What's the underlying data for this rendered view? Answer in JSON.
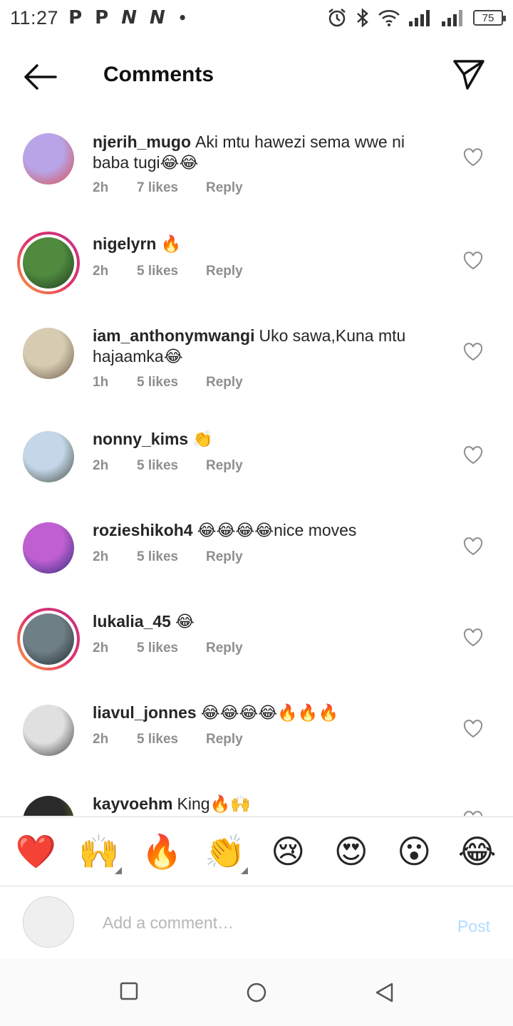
{
  "status_bar": {
    "time": "11:27",
    "notifications": [
      "P",
      "P",
      "N",
      "N",
      "•"
    ],
    "battery": "75"
  },
  "header": {
    "title": "Comments"
  },
  "comments": [
    {
      "username": "njerih_mugo",
      "text": "Aki  mtu hawezi sema wwe ni baba tugi😂😂",
      "time": "2h",
      "likes": "7 likes",
      "reply": "Reply",
      "story_ring": false,
      "avatar_colors": [
        "#b8a4e6",
        "#d84a4a"
      ]
    },
    {
      "username": "nigelyrn",
      "text": "🔥",
      "time": "2h",
      "likes": "5 likes",
      "reply": "Reply",
      "story_ring": true,
      "avatar_colors": [
        "#4f8a3f",
        "#1d3a1d"
      ]
    },
    {
      "username": "iam_anthonymwangi",
      "text": "Uko sawa,Kuna mtu hajaamka😂",
      "time": "1h",
      "likes": "5 likes",
      "reply": "Reply",
      "story_ring": false,
      "avatar_colors": [
        "#d7cbb2",
        "#6a5a45"
      ]
    },
    {
      "username": "nonny_kims",
      "text": "👏",
      "time": "2h",
      "likes": "5 likes",
      "reply": "Reply",
      "story_ring": false,
      "avatar_colors": [
        "#c5d6e8",
        "#3d4a3c"
      ]
    },
    {
      "username": "rozieshikoh4",
      "text": "😂😂😂😂nice moves",
      "time": "2h",
      "likes": "5 likes",
      "reply": "Reply",
      "story_ring": false,
      "avatar_colors": [
        "#c060d0",
        "#2a2a7a"
      ]
    },
    {
      "username": "lukalia_45",
      "text": "😂",
      "time": "2h",
      "likes": "5 likes",
      "reply": "Reply",
      "story_ring": true,
      "avatar_colors": [
        "#6f7f86",
        "#1f2a30"
      ]
    },
    {
      "username": "liavul_jonnes",
      "text": "😂😂😂😂🔥🔥🔥",
      "time": "2h",
      "likes": "5 likes",
      "reply": "Reply",
      "story_ring": false,
      "avatar_colors": [
        "#e0e0e0",
        "#3a3a3a"
      ]
    },
    {
      "username": "kayvoehm",
      "text": "King🔥🙌",
      "time": "",
      "likes": "",
      "reply": "",
      "story_ring": false,
      "avatar_colors": [
        "#2a2a2a",
        "#6a8a2a"
      ]
    }
  ],
  "emoji_bar": [
    {
      "name": "heart-emoji",
      "char": "❤️",
      "has_variants": false
    },
    {
      "name": "raised-hands-emoji",
      "char": "🙌",
      "has_variants": true
    },
    {
      "name": "fire-emoji",
      "char": "🔥",
      "has_variants": false
    },
    {
      "name": "clapping-emoji",
      "char": "👏",
      "has_variants": true
    },
    {
      "name": "crying-face-emoji",
      "char": "😢",
      "has_variants": false
    },
    {
      "name": "heart-eyes-emoji",
      "char": "😍",
      "has_variants": false
    },
    {
      "name": "surprised-face-emoji",
      "char": "😮",
      "has_variants": false
    },
    {
      "name": "tears-of-joy-emoji",
      "char": "😂",
      "has_variants": false
    }
  ],
  "input": {
    "placeholder": "Add a comment…",
    "value": "",
    "post_label": "Post"
  },
  "colors": {
    "post_disabled": "#b3dbff",
    "meta_gray": "#8e8e8e",
    "heart_outline": "#8e8e8e"
  }
}
